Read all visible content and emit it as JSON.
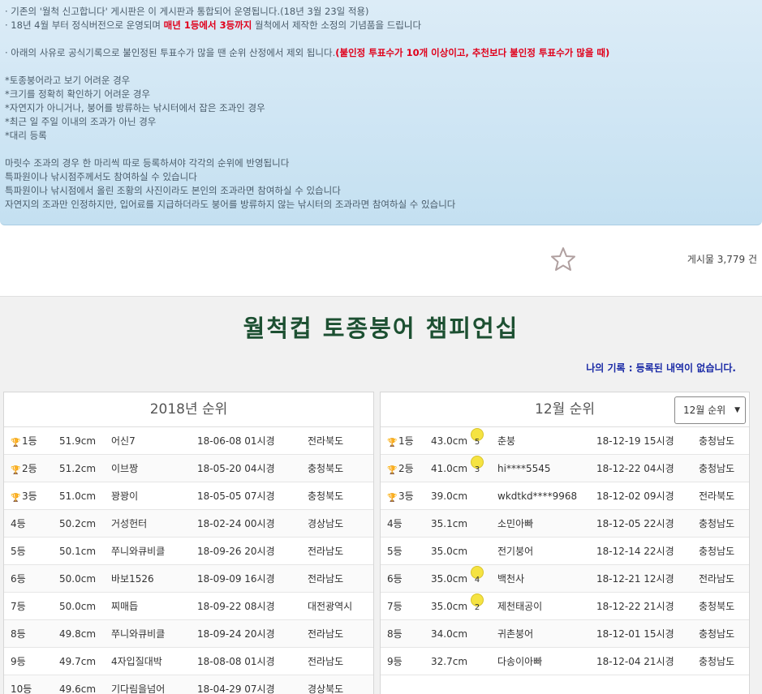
{
  "notice": {
    "lines": [
      "· 기존의 '월척 신고합니다' 게시판은 이 게시판과 통합되어 운영됩니다.(18년 3월 23일 적용)",
      "· 18년 4월 부터 정식버전으로 운영되며 ",
      "매년 1등에서 3등까지",
      " 월척에서 제작한 소정의 기념품을 드립니다",
      "· 아래의 사유로 공식기록으로 불인정된 투표수가 많을 땐 순위 산정에서 제외 됩니다.",
      "(불인정 투표수가 10개 이상이고, 추천보다 불인정 투표수가 많을 때)"
    ],
    "reasons": [
      "*토종붕어라고 보기 어려운 경우",
      "*크기를 정확히 확인하기 어려운 경우",
      "*자연지가 아니거나, 붕어를 방류하는 낚시터에서 잡은 조과인 경우",
      "*최근 일 주일 이내의 조과가 아닌 경우",
      "*대리 등록"
    ],
    "rules": [
      "마릿수 조과의 경우 한 마리씩 따로 등록하셔야 각각의 순위에 반영됩니다",
      "특파원이나 낚시점주께서도 참여하실 수 있습니다",
      "특파원이나 낚시점에서 올린 조황의 사진이라도 본인의 조과라면 참여하실 수 있습니다",
      "자연지의 조과만 인정하지만, 입어료를 지급하더라도 붕어를 방류하지 않는 낚시터의 조과라면 참여하실 수 있습니다"
    ]
  },
  "toolbar": {
    "post_count": "게시물 3,779 건"
  },
  "board": {
    "title": "월척컵 토종붕어 챔피언십",
    "my_record": "나의 기록 : 등록된 내역이 없습니다."
  },
  "yearly": {
    "title": "2018년 순위",
    "rows": [
      {
        "rank": "1등",
        "trophy": "gold",
        "size": "51.9cm",
        "name": "어신7",
        "date": "18-06-08 01시경",
        "region": "전라북도"
      },
      {
        "rank": "2등",
        "trophy": "silver",
        "size": "51.2cm",
        "name": "이브짱",
        "date": "18-05-20 04시경",
        "region": "충청북도"
      },
      {
        "rank": "3등",
        "trophy": "bronze",
        "size": "51.0cm",
        "name": "꽝꽝이",
        "date": "18-05-05 07시경",
        "region": "충청북도"
      },
      {
        "rank": "4등",
        "trophy": "",
        "size": "50.2cm",
        "name": "거성헌터",
        "date": "18-02-24 00시경",
        "region": "경상남도"
      },
      {
        "rank": "5등",
        "trophy": "",
        "size": "50.1cm",
        "name": "쭈니와큐비클",
        "date": "18-09-26 20시경",
        "region": "전라남도"
      },
      {
        "rank": "6등",
        "trophy": "",
        "size": "50.0cm",
        "name": "바보1526",
        "date": "18-09-09 16시경",
        "region": "전라남도"
      },
      {
        "rank": "7등",
        "trophy": "",
        "size": "50.0cm",
        "name": "찌매듭",
        "date": "18-09-22 08시경",
        "region": "대전광역시"
      },
      {
        "rank": "8등",
        "trophy": "",
        "size": "49.8cm",
        "name": "쭈니와큐비클",
        "date": "18-09-24 20시경",
        "region": "전라남도"
      },
      {
        "rank": "9등",
        "trophy": "",
        "size": "49.7cm",
        "name": "4자입질대박",
        "date": "18-08-08 01시경",
        "region": "전라남도"
      },
      {
        "rank": "10등",
        "trophy": "",
        "size": "49.6cm",
        "name": "기다림을넘어",
        "date": "18-04-29 07시경",
        "region": "경상북도"
      }
    ]
  },
  "monthly": {
    "title": "12월 순위",
    "select_value": "12월 순위",
    "rows": [
      {
        "rank": "1등",
        "trophy": "gold",
        "size": "43.0cm",
        "badge": "5",
        "name": "춘붕",
        "date": "18-12-19 15시경",
        "region": "충청남도"
      },
      {
        "rank": "2등",
        "trophy": "silver",
        "size": "41.0cm",
        "badge": "3",
        "name": "hi****5545",
        "date": "18-12-22 04시경",
        "region": "충청남도"
      },
      {
        "rank": "3등",
        "trophy": "bronze",
        "size": "39.0cm",
        "badge": "",
        "name": "wkdtkd****9968",
        "date": "18-12-02 09시경",
        "region": "전라북도"
      },
      {
        "rank": "4등",
        "trophy": "",
        "size": "35.1cm",
        "badge": "",
        "name": "소민아빠",
        "date": "18-12-05 22시경",
        "region": "충청남도"
      },
      {
        "rank": "5등",
        "trophy": "",
        "size": "35.0cm",
        "badge": "",
        "name": "전기붕어",
        "date": "18-12-14 22시경",
        "region": "충청남도"
      },
      {
        "rank": "6등",
        "trophy": "",
        "size": "35.0cm",
        "badge": "4",
        "name": "백천사",
        "date": "18-12-21 12시경",
        "region": "전라남도"
      },
      {
        "rank": "7등",
        "trophy": "",
        "size": "35.0cm",
        "badge": "2",
        "name": "제천태공이",
        "date": "18-12-22 21시경",
        "region": "충청북도"
      },
      {
        "rank": "8등",
        "trophy": "",
        "size": "34.0cm",
        "badge": "",
        "name": "귀촌붕어",
        "date": "18-12-01 15시경",
        "region": "충청남도"
      },
      {
        "rank": "9등",
        "trophy": "",
        "size": "32.7cm",
        "badge": "",
        "name": "다송이아빠",
        "date": "18-12-04 21시경",
        "region": "충청남도"
      }
    ]
  },
  "colors": {
    "gold": "#e5b800",
    "silver": "#a8a8a8",
    "bronze": "#c9862c"
  }
}
